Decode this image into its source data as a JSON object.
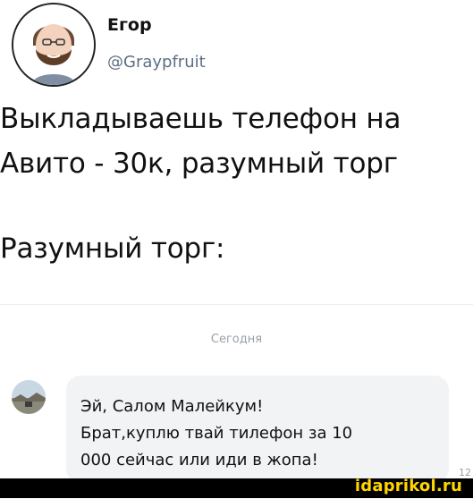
{
  "author": {
    "name": "Егор",
    "handle": "@Graypfruit"
  },
  "tweet": {
    "lines": [
      "Выкладываешь телефон на",
      "Авито - 30к, разумный торг"
    ],
    "second_paragraph": "Разумный торг:"
  },
  "chat": {
    "date_label": "Сегодня",
    "message_lines": [
      "Эй, Салом Малейкум!",
      "Брат,куплю твай тилефон за 10",
      "000 сейчас или иди в жопа!"
    ],
    "time_fragment": "12"
  },
  "watermark": {
    "text": "idaprikol.ru"
  },
  "colors": {
    "handle": "#5b7083",
    "bubble_bg": "#f2f3f5",
    "watermark_text": "#ffd400",
    "watermark_bar": "#000000"
  }
}
